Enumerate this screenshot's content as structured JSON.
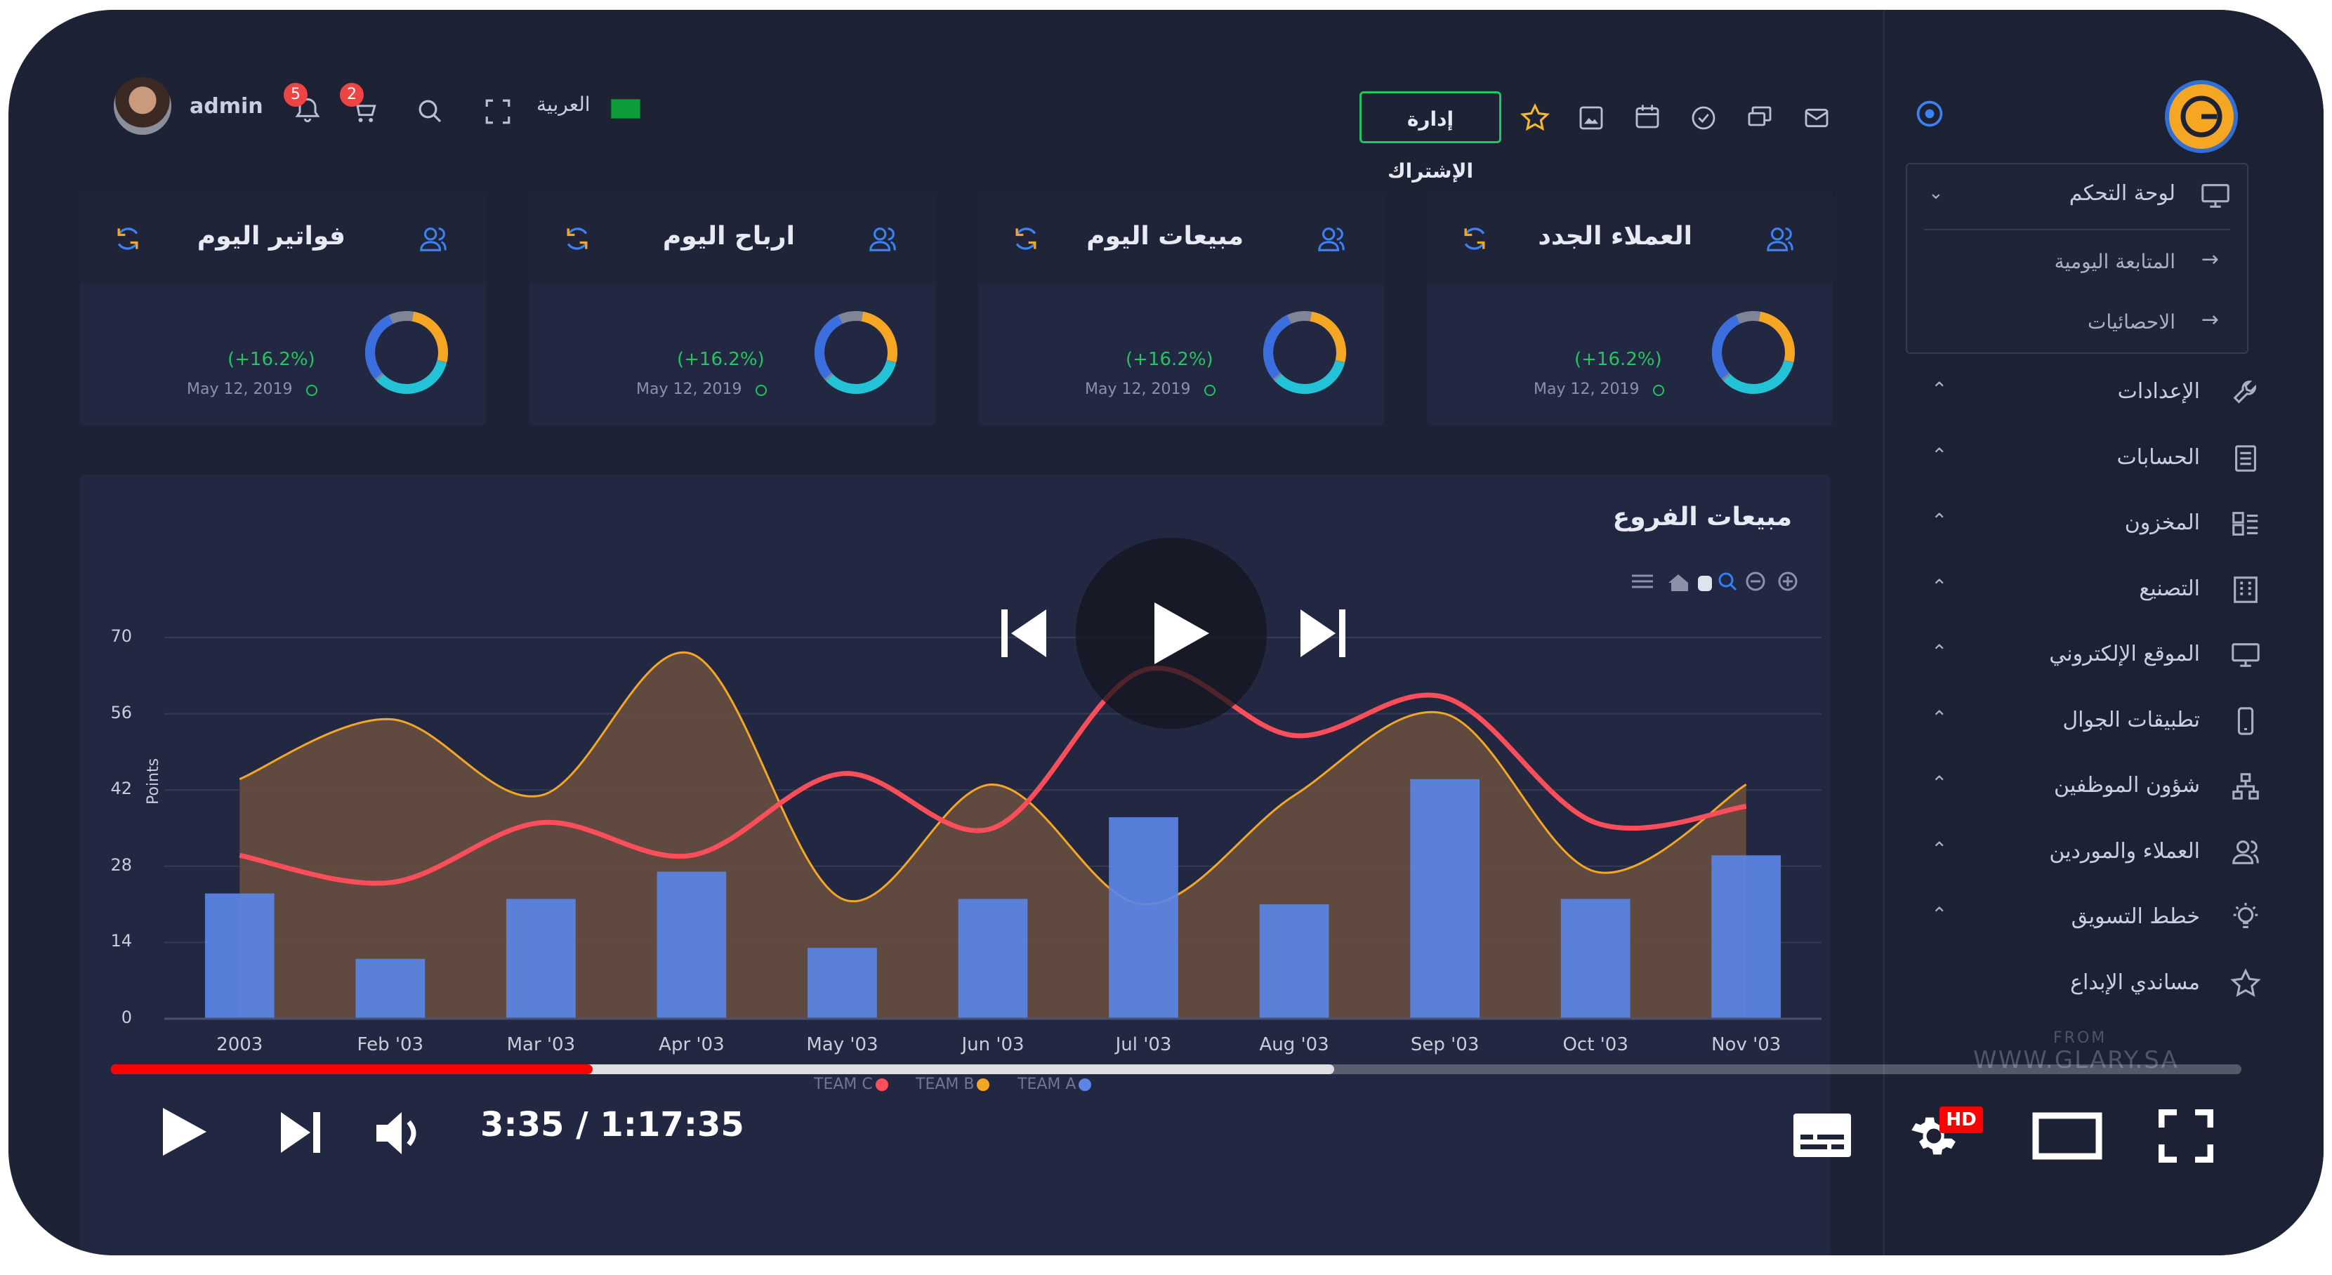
{
  "header": {
    "user": "admin",
    "notifications_count": "5",
    "cart_count": "2",
    "language": "العربية",
    "subscription_button": "إدارة الإشتراك"
  },
  "cards": [
    {
      "title": "فواتير اليوم",
      "pct": "(+16.2%)",
      "date": "May 12, 2019"
    },
    {
      "title": "ارباح اليوم",
      "pct": "(+16.2%)",
      "date": "May 12, 2019"
    },
    {
      "title": "مبيعات اليوم",
      "pct": "(+16.2%)",
      "date": "May 12, 2019"
    },
    {
      "title": "العملاء الجدد",
      "pct": "(+16.2%)",
      "date": "May 12, 2019"
    }
  ],
  "sidebar": {
    "dashboard": "لوحة التحكم",
    "sub_items": [
      "المتابعة اليومية",
      "الاحصائيات"
    ],
    "items": [
      {
        "label": "الإعدادات",
        "icon": "wrench-icon"
      },
      {
        "label": "الحسابات",
        "icon": "ledger-icon"
      },
      {
        "label": "المخزون",
        "icon": "inventory-icon"
      },
      {
        "label": "التصنيع",
        "icon": "factory-icon"
      },
      {
        "label": "الموقع الإلكتروني",
        "icon": "monitor-icon"
      },
      {
        "label": "تطبيقات الجوال",
        "icon": "mobile-icon"
      },
      {
        "label": "شؤون الموظفين",
        "icon": "org-chart-icon"
      },
      {
        "label": "العملاء والموردين",
        "icon": "users-icon"
      },
      {
        "label": "خطط التسويق",
        "icon": "bulb-icon"
      },
      {
        "label": "مساندي الإبداع",
        "icon": "star-icon"
      }
    ],
    "footer_from": "FROM",
    "footer_site": "WWW.GLARY.SA"
  },
  "chart_title": "مبيعات الفروع",
  "chart_data": {
    "type": "bar",
    "categories": [
      "2003",
      "Feb '03",
      "Mar '03",
      "Apr '03",
      "May '03",
      "Jun '03",
      "Jul '03",
      "Aug '03",
      "Sep '03",
      "Oct '03",
      "Nov '03"
    ],
    "ylabel": "Points",
    "ylim": [
      0,
      70
    ],
    "yticks": [
      0,
      14,
      28,
      42,
      56,
      70
    ],
    "series": [
      {
        "name": "TEAM A",
        "type": "bar",
        "color": "#5b86e5",
        "values": [
          23,
          11,
          22,
          27,
          13,
          22,
          37,
          21,
          44,
          22,
          30
        ]
      },
      {
        "name": "TEAM B",
        "type": "area",
        "color": "#f5a623",
        "values": [
          44,
          55,
          41,
          67,
          22,
          43,
          21,
          41,
          56,
          27,
          43
        ]
      },
      {
        "name": "TEAM C",
        "type": "line",
        "color": "#ff4d5a",
        "values": [
          30,
          25,
          36,
          30,
          45,
          35,
          64,
          52,
          59,
          36,
          39
        ]
      }
    ]
  },
  "player": {
    "time": "3:35 / 1:17:35",
    "progress_played": 0.226,
    "progress_buffered": 0.574,
    "hd_badge": "HD"
  },
  "colors": {
    "background": "#1d2234",
    "panel": "#222842",
    "accent": "#22c55e",
    "progress": "#ff0000"
  }
}
